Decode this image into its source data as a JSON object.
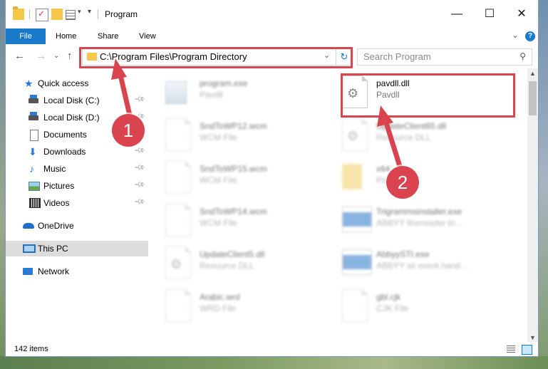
{
  "window": {
    "title": "Program",
    "controls": {
      "minimize": "—",
      "maximize": "☐",
      "close": "✕"
    }
  },
  "ribbon": {
    "tabs": [
      "File",
      "Home",
      "Share",
      "View"
    ],
    "help": "?"
  },
  "address_bar": {
    "path": "C:\\Program Files\\Program Directory",
    "refresh_icon": "↻"
  },
  "search": {
    "placeholder": "Search Program"
  },
  "nav_pane": {
    "items": [
      {
        "label": "Quick access",
        "icon": "star-icon"
      },
      {
        "label": "Local Disk (C:)",
        "icon": "disk-icon",
        "pinned": true
      },
      {
        "label": "Local Disk (D:)",
        "icon": "disk-icon",
        "pinned": true
      },
      {
        "label": "Documents",
        "icon": "document-icon",
        "pinned": true
      },
      {
        "label": "Downloads",
        "icon": "download-icon",
        "pinned": true
      },
      {
        "label": "Music",
        "icon": "music-icon",
        "pinned": true
      },
      {
        "label": "Pictures",
        "icon": "pictures-icon",
        "pinned": true
      },
      {
        "label": "Videos",
        "icon": "videos-icon",
        "pinned": true
      },
      {
        "label": "OneDrive",
        "icon": "onedrive-icon"
      },
      {
        "label": "This PC",
        "icon": "pc-icon",
        "selected": true
      },
      {
        "label": "Network",
        "icon": "network-icon"
      }
    ]
  },
  "files": [
    {
      "name": "program.exe",
      "type": "Pavdll",
      "thumb": "exe"
    },
    {
      "name": "pavdll.dll",
      "type": "Pavdll",
      "thumb": "dll",
      "highlighted": true
    },
    {
      "name": "SndToWP12.wcm",
      "type": "WCM File",
      "thumb": "doc"
    },
    {
      "name": "UpdateClient65.dll",
      "type": "Resource DLL",
      "thumb": "dll"
    },
    {
      "name": "SndToWP15.wcm",
      "type": "WCM File",
      "thumb": "doc"
    },
    {
      "name": "x64",
      "type": "Pav",
      "thumb": "folder"
    },
    {
      "name": "SndToWP14.wcm",
      "type": "WCM File",
      "thumb": "doc"
    },
    {
      "name": "Trigrammsinstaller.exe",
      "type": "ABBYY finereader tri...",
      "thumb": "blue"
    },
    {
      "name": "UpdateClient5.dll",
      "type": "Resource DLL",
      "thumb": "dll"
    },
    {
      "name": "AbbyySTI.exe",
      "type": "ABBYY sti event hand...",
      "thumb": "blue"
    },
    {
      "name": "Arabic.wrd",
      "type": "WRD File",
      "thumb": "doc"
    },
    {
      "name": "gbl.cjk",
      "type": "CJK File",
      "thumb": "doc"
    }
  ],
  "status": {
    "item_count": "142 items"
  },
  "annotations": {
    "step1": "1",
    "step2": "2"
  },
  "colors": {
    "accent": "#1979ca",
    "highlight": "#d9444e"
  }
}
